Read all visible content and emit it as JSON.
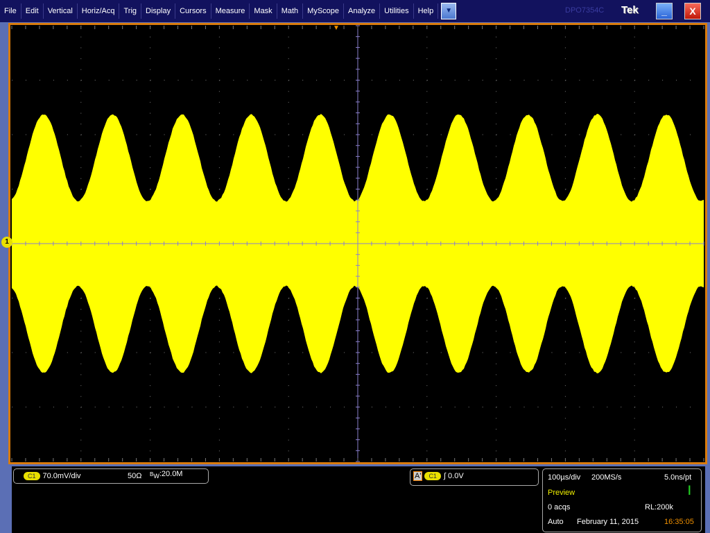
{
  "menu": [
    "File",
    "Edit",
    "Vertical",
    "Horiz/Acq",
    "Trig",
    "Display",
    "Cursors",
    "Measure",
    "Mask",
    "Math",
    "MyScope",
    "Analyze",
    "Utilities",
    "Help"
  ],
  "title": {
    "model": "DPO7354C",
    "brand": "Tek",
    "minimize": "_",
    "close": "X"
  },
  "colors": {
    "trace": "#ffff00",
    "graticule": "#7a7a7a",
    "center_axis": "#8a7fcc",
    "frame": "#d97b0d"
  },
  "waveform": {
    "type": "AM sine",
    "envelope_cycles_on_screen": 10,
    "envelope_min_div": 0.78,
    "envelope_max_div": 2.37
  },
  "channel": {
    "badge": "C1",
    "scale": "70.0mV/div",
    "impedance": "50Ω",
    "bw_prefix": "B",
    "bw_sub": "W",
    "bw": ":20.0M",
    "marker": "1"
  },
  "trigger": {
    "source_label": "A'",
    "badge": "C1",
    "slope": "rising-edge-icon",
    "level": "0.0V"
  },
  "acq": {
    "timebase": "100µs/div",
    "rate": "200MS/s",
    "resolution": "5.0ns/pt",
    "state": "Preview",
    "acqs": "0 acqs",
    "rl": "RL:200k",
    "mode": "Auto",
    "date": "February 11, 2015",
    "time": "16:35:05"
  }
}
